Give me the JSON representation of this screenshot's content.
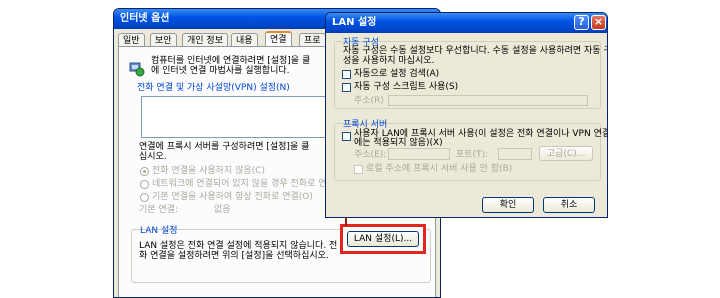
{
  "back_window": {
    "title": "인터넷 옵션",
    "tabs": [
      "일반",
      "보안",
      "개인 정보",
      "내용",
      "연결",
      "프로"
    ],
    "setup_text_line1": "컴퓨터를 인터넷에 연결하려면 [설정]을 클",
    "setup_text_line2": "에 인터넷 연결 마법사를 실행합니다.",
    "vpn_label": "전화 연결 및 가상 사설망(VPN) 설정(N)",
    "proxy_text_line1": "연결에 프록시 서버를 구성하려면 [설정]을 클",
    "proxy_text_line2": "십시오.",
    "radio_1": "전화 연결을 사용하지 않음(C)",
    "radio_2": "네트워크에 연결되어 있지 않을 경우 전화로 연",
    "radio_3": "기본 연결을 사용하여 항상 전화로 연결(O)",
    "default_conn_label": "기본 연결:",
    "default_conn_value": "없음",
    "lan_group_label": "LAN 설정",
    "lan_text_line1": "LAN 설정은 전화 연결 설정에 적용되지 않습니다. 전",
    "lan_text_line2": "화 연결을 설정하려면 위의 [설정]을 선택하십시오.",
    "lan_button": "LAN 설정(L)..."
  },
  "front_window": {
    "title": "LAN 설정",
    "auto_group_label": "자동 구성",
    "auto_text_line1": "자동 구성은 수동 설정보다 우선합니다. 수동 설정을 사용하려면 자동 구",
    "auto_text_line2": "성을 사용하지 마십시오.",
    "auto_detect_label": "자동으로 설정 검색(A)",
    "auto_script_label": "자동 구성 스크립트 사용(S)",
    "address_label": "주소(R)",
    "proxy_group_label": "프록시 서버",
    "proxy_use_line1": "사용자 LAN에 프록시 서버 사용(이 설정은 전화 연결이나 VPN 연결",
    "proxy_use_line2": "에는 적용되지 않음)(X)",
    "proxy_address_label": "주소(E):",
    "proxy_port_label": "포트(T):",
    "advanced_button": "고급(C)...",
    "bypass_label": "로컬 주소에 프록시 서버 사용 안 함(B)",
    "ok_button": "확인",
    "cancel_button": "취소"
  },
  "highlight_color": "#e0261d",
  "arrow_color": "#9c1a1f"
}
